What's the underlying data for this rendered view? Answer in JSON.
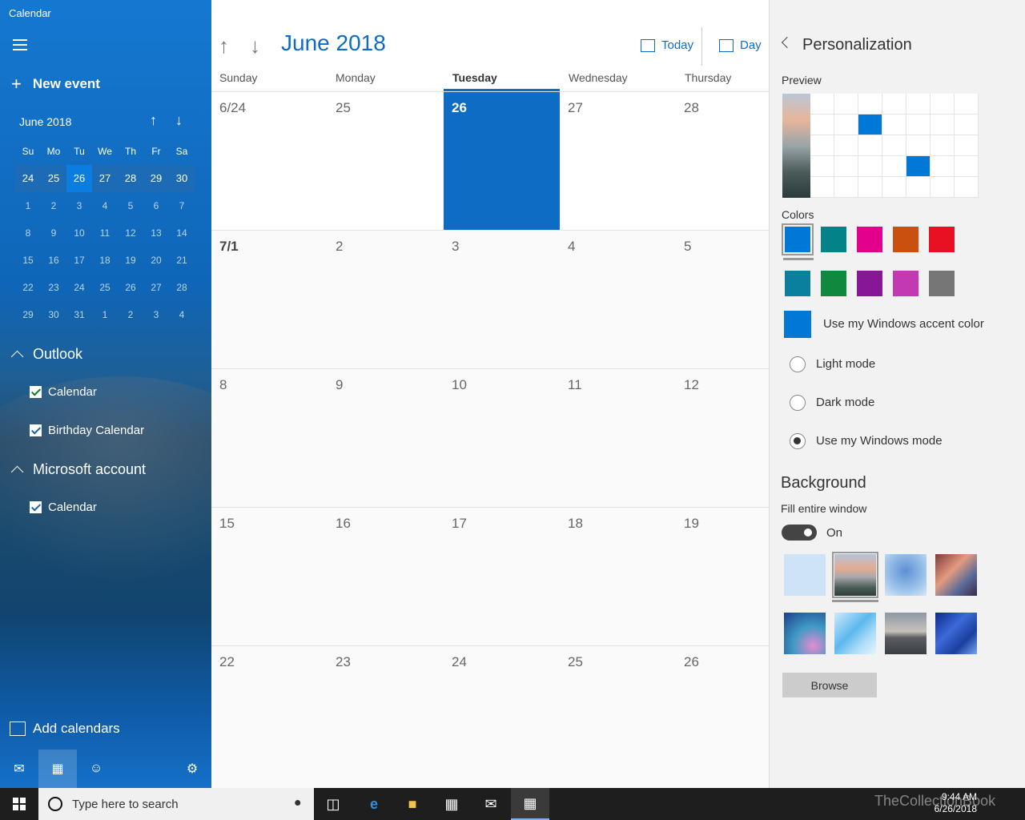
{
  "app": {
    "title": "Calendar"
  },
  "sidebar": {
    "new_event": "New event",
    "mini": {
      "title": "June 2018",
      "weekdays": [
        "Su",
        "Mo",
        "Tu",
        "We",
        "Th",
        "Fr",
        "Sa"
      ],
      "weeks": [
        [
          "24",
          "25",
          "26",
          "27",
          "28",
          "29",
          "30"
        ],
        [
          "1",
          "2",
          "3",
          "4",
          "5",
          "6",
          "7"
        ],
        [
          "8",
          "9",
          "10",
          "11",
          "12",
          "13",
          "14"
        ],
        [
          "15",
          "16",
          "17",
          "18",
          "19",
          "20",
          "21"
        ],
        [
          "22",
          "23",
          "24",
          "25",
          "26",
          "27",
          "28"
        ],
        [
          "29",
          "30",
          "31",
          "1",
          "2",
          "3",
          "4"
        ]
      ]
    },
    "groups": [
      {
        "name": "Outlook",
        "calendars": [
          "Calendar",
          "Birthday Calendar"
        ]
      },
      {
        "name": "Microsoft account",
        "calendars": [
          "Calendar"
        ]
      }
    ],
    "add_calendars": "Add calendars"
  },
  "main": {
    "title": "June 2018",
    "today_btn": "Today",
    "view_btn": "Day",
    "weekdays": [
      "Sunday",
      "Monday",
      "Tuesday",
      "Wednesday",
      "Thursday"
    ],
    "weeks": [
      [
        "6/24",
        "25",
        "26",
        "27",
        "28"
      ],
      [
        "7/1",
        "2",
        "3",
        "4",
        "5"
      ],
      [
        "8",
        "9",
        "10",
        "11",
        "12"
      ],
      [
        "15",
        "16",
        "17",
        "18",
        "19"
      ],
      [
        "22",
        "23",
        "24",
        "25",
        "26"
      ]
    ]
  },
  "panel": {
    "title": "Personalization",
    "preview_label": "Preview",
    "colors_label": "Colors",
    "colors": [
      "#0078d7",
      "#038387",
      "#e3008c",
      "#ca5010",
      "#e81123",
      "#0b7f9e",
      "#10893e",
      "#881798",
      "#c239b3",
      "#767676"
    ],
    "accent_label": "Use my Windows accent color",
    "modes": [
      "Light mode",
      "Dark mode",
      "Use my Windows mode"
    ],
    "background_title": "Background",
    "fill_label": "Fill entire window",
    "toggle_state": "On",
    "browse": "Browse"
  },
  "taskbar": {
    "search_placeholder": "Type here to search",
    "time": "9:44 AM",
    "date": "6/26/2018",
    "watermark": "TheCollectionBook"
  }
}
